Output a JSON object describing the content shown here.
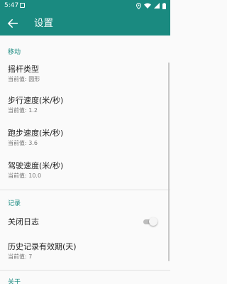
{
  "status_bar": {
    "time": "5:47",
    "notification_icon": "notification-icon",
    "icons": [
      "location-icon",
      "wifi-icon",
      "signal-icon",
      "battery-icon"
    ]
  },
  "app_bar": {
    "title": "设置",
    "back_icon": "arrow-left-icon",
    "background": "#1a8a80"
  },
  "sections": {
    "move": {
      "header": "移动",
      "joystick": {
        "title": "摇杆类型",
        "summary": "当前值: 圆形"
      },
      "walk_speed": {
        "title": "步行速度(米/秒)",
        "summary": "当前值: 1.2"
      },
      "run_speed": {
        "title": "跑步速度(米/秒)",
        "summary": "当前值: 3.6"
      },
      "drive_speed": {
        "title": "驾驶速度(米/秒)",
        "summary": "当前值: 10.0"
      }
    },
    "log": {
      "header": "记录",
      "close_log": {
        "title": "关闭日志",
        "enabled": false
      },
      "history_validity": {
        "title": "历史记录有效期(天)",
        "summary": "当前值: 7"
      }
    },
    "about": {
      "header": "关于"
    }
  },
  "colors": {
    "accent": "#1a8a80",
    "title_text": "#212121",
    "summary_text": "#757575"
  }
}
